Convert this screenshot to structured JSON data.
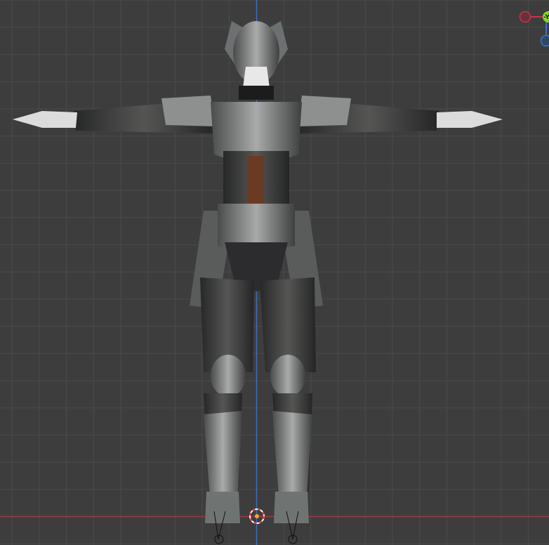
{
  "viewport": {
    "background": "#3d3d3d",
    "grid_color": "#4b4b4b",
    "x_axis_color": "#9b3a47",
    "z_axis_color": "#3d6fb8"
  },
  "gizmo": {
    "x_color": "#c8324b",
    "y_color": "#8ad42a",
    "z_color": "#3a74c9",
    "y_label": "-Y"
  },
  "cursor": {
    "ring_colors": [
      "#e33b3b",
      "#ffffff"
    ],
    "origin_color": "#f5a623"
  }
}
